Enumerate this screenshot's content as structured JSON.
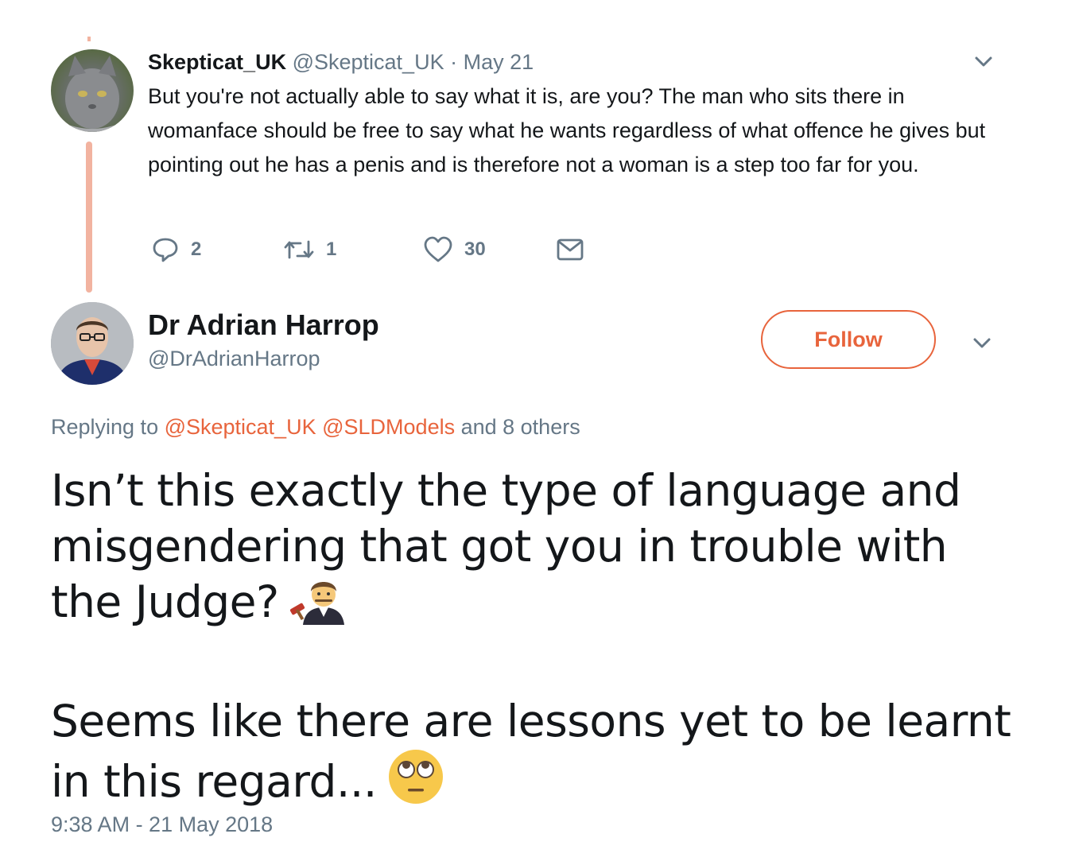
{
  "tweet1": {
    "name": "Skepticat_UK",
    "handle": "@Skepticat_UK",
    "separator": " · ",
    "date": "May 21",
    "text": "But you're not actually able to say what it is, are you? The man who sits there in womanface should be free to say what he wants regardless of what offence he gives  but pointing out he has a penis and is therefore not a woman is a step too far for you.",
    "replies": "2",
    "retweets": "1",
    "likes": "30"
  },
  "tweet2": {
    "name": "Dr Adrian Harrop",
    "handle": "@DrAdrianHarrop",
    "follow_label": "Follow",
    "replying_prefix": "Replying to ",
    "replying_mention1": "@Skepticat_UK",
    "replying_mention2": "@SLDModels",
    "replying_suffix": " and 8 others",
    "text_para1": "Isn’t this exactly the type of language and misgendering that got you in trouble with the Judge?",
    "text_para2": "Seems like there are lessons yet to be learnt in this regard...",
    "emoji1": "judge-emoji",
    "emoji2": "eye-roll-emoji",
    "timestamp": "9:38 AM - 21 May 2018"
  },
  "colors": {
    "accent": "#e8643c",
    "secondary_text": "#657786",
    "thread_line": "#f2b3a0"
  }
}
